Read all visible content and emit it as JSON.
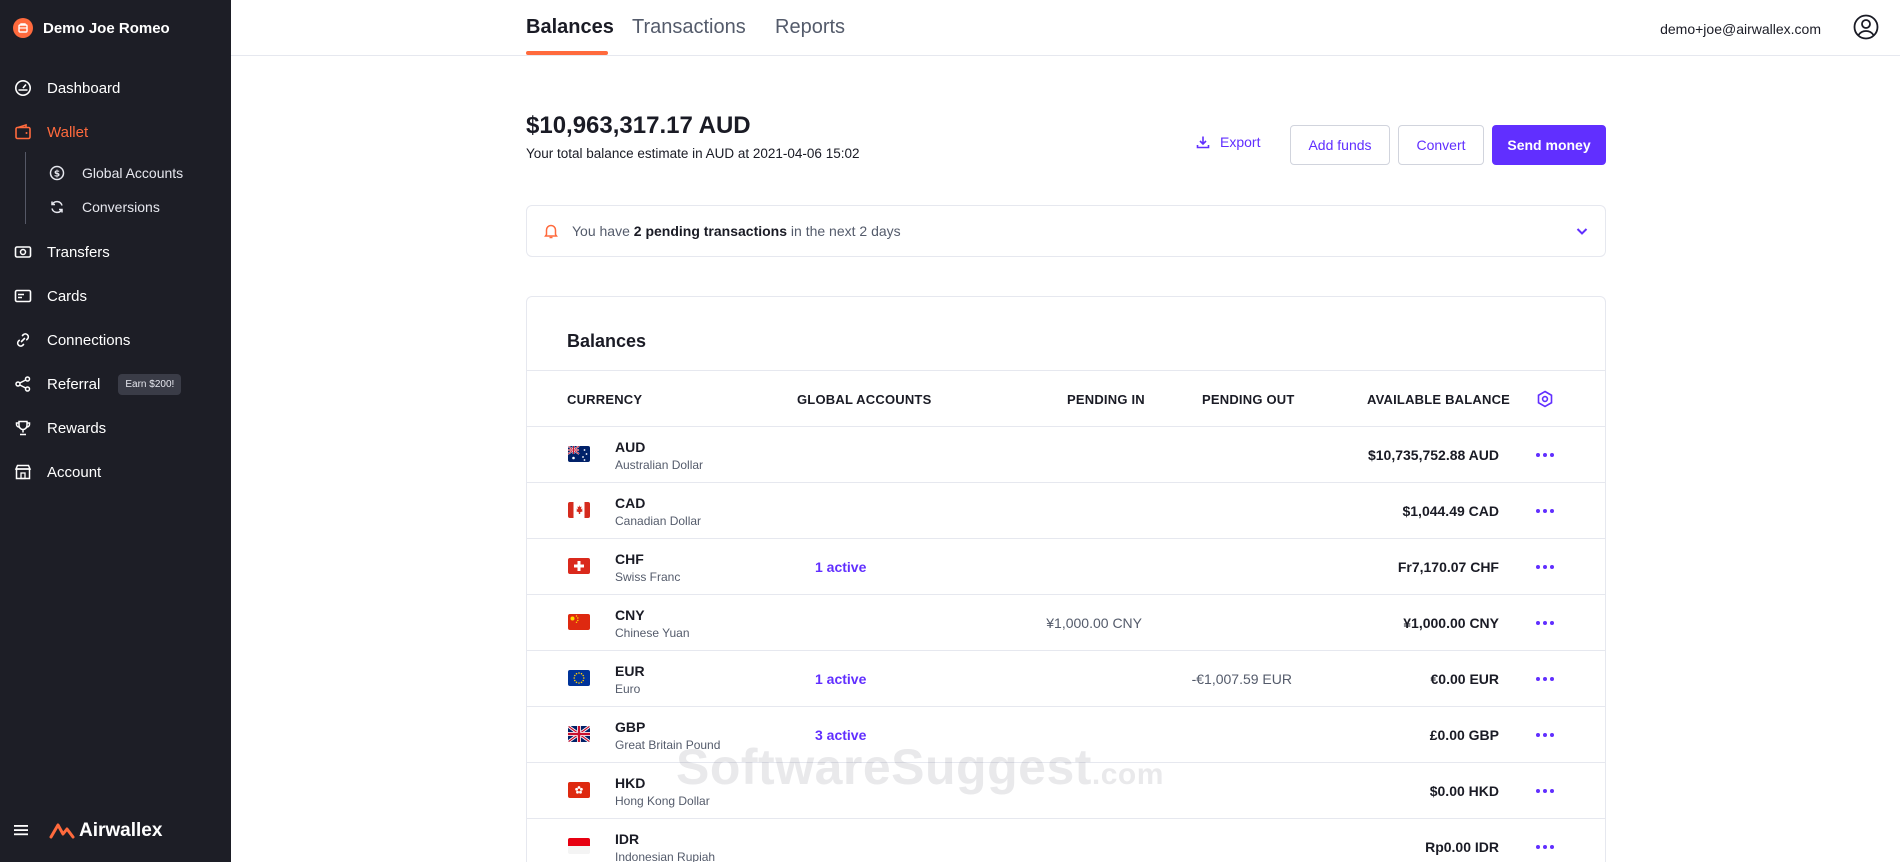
{
  "sidebar": {
    "org_name": "Demo Joe Romeo",
    "items": [
      {
        "label": "Dashboard",
        "icon": "dashboard-icon"
      },
      {
        "label": "Wallet",
        "icon": "wallet-icon",
        "active": true
      },
      {
        "label": "Transfers",
        "icon": "transfers-icon"
      },
      {
        "label": "Cards",
        "icon": "cards-icon"
      },
      {
        "label": "Connections",
        "icon": "link-icon"
      },
      {
        "label": "Referral",
        "icon": "share-icon",
        "badge": "Earn $200!"
      },
      {
        "label": "Rewards",
        "icon": "trophy-icon"
      },
      {
        "label": "Account",
        "icon": "building-icon"
      }
    ],
    "wallet_subitems": [
      {
        "label": "Global Accounts",
        "icon": "dollar-circle-icon"
      },
      {
        "label": "Conversions",
        "icon": "refresh-icon"
      }
    ],
    "brand": "Airwallex"
  },
  "header": {
    "tabs": [
      {
        "label": "Balances",
        "active": true
      },
      {
        "label": "Transactions"
      },
      {
        "label": "Reports"
      }
    ],
    "email": "demo+joe@airwallex.com"
  },
  "summary": {
    "total": "$10,963,317.17 AUD",
    "subtitle": "Your total balance estimate in AUD at 2021-04-06 15:02",
    "export_label": "Export",
    "add_funds_label": "Add funds",
    "convert_label": "Convert",
    "send_money_label": "Send money"
  },
  "pending": {
    "prefix": "You have ",
    "bold": "2 pending transactions",
    "suffix": " in the next 2 days"
  },
  "balances": {
    "title": "Balances",
    "columns": [
      "CURRENCY",
      "GLOBAL ACCOUNTS",
      "PENDING IN",
      "PENDING OUT",
      "AVAILABLE BALANCE"
    ],
    "rows": [
      {
        "code": "AUD",
        "name": "Australian Dollar",
        "global_accounts": "",
        "pending_in": "",
        "pending_out": "",
        "available": "$10,735,752.88 AUD"
      },
      {
        "code": "CAD",
        "name": "Canadian Dollar",
        "global_accounts": "",
        "pending_in": "",
        "pending_out": "",
        "available": "$1,044.49 CAD"
      },
      {
        "code": "CHF",
        "name": "Swiss Franc",
        "global_accounts": "1 active",
        "pending_in": "",
        "pending_out": "",
        "available": "Fr7,170.07 CHF"
      },
      {
        "code": "CNY",
        "name": "Chinese Yuan",
        "global_accounts": "",
        "pending_in": "¥1,000.00 CNY",
        "pending_out": "",
        "available": "¥1,000.00 CNY"
      },
      {
        "code": "EUR",
        "name": "Euro",
        "global_accounts": "1 active",
        "pending_in": "",
        "pending_out": "-€1,007.59 EUR",
        "available": "€0.00 EUR"
      },
      {
        "code": "GBP",
        "name": "Great Britain Pound",
        "global_accounts": "3 active",
        "pending_in": "",
        "pending_out": "",
        "available": "£0.00 GBP"
      },
      {
        "code": "HKD",
        "name": "Hong Kong Dollar",
        "global_accounts": "",
        "pending_in": "",
        "pending_out": "",
        "available": "$0.00 HKD"
      },
      {
        "code": "IDR",
        "name": "Indonesian Rupiah",
        "global_accounts": "",
        "pending_in": "",
        "pending_out": "",
        "available": "Rp0.00 IDR"
      }
    ]
  },
  "watermark": {
    "main": "SoftwareSuggest",
    "suffix": ".com"
  },
  "colors": {
    "accent": "#612fff",
    "brand_orange": "#ff6a3d",
    "sidebar_bg": "#1d1e26"
  }
}
